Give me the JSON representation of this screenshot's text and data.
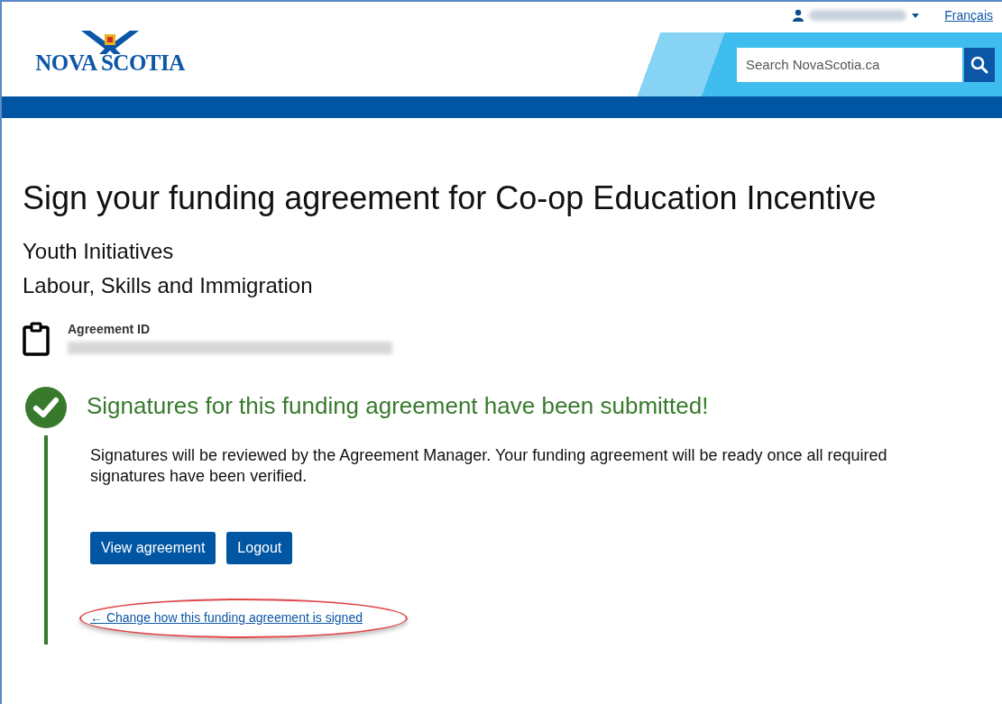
{
  "header": {
    "logo": "NOVA SCOTIA",
    "language_link": "Français",
    "search": {
      "placeholder": "Search NovaScotia.ca"
    }
  },
  "page": {
    "title": "Sign your funding agreement for Co-op Education Incentive",
    "subtitles": [
      "Youth Initiatives",
      "Labour, Skills and Immigration"
    ],
    "agreement": {
      "label": "Agreement ID"
    },
    "status": {
      "heading": "Signatures for this funding agreement have been submitted!",
      "message": "Signatures will be reviewed by the Agreement Manager. Your funding agreement will be ready once all required signatures have been verified.",
      "buttons": [
        "View agreement",
        "Logout"
      ],
      "link": {
        "arrow": "←",
        "label": "Change how this funding agreement is signed",
        "highlighted": true
      }
    }
  }
}
